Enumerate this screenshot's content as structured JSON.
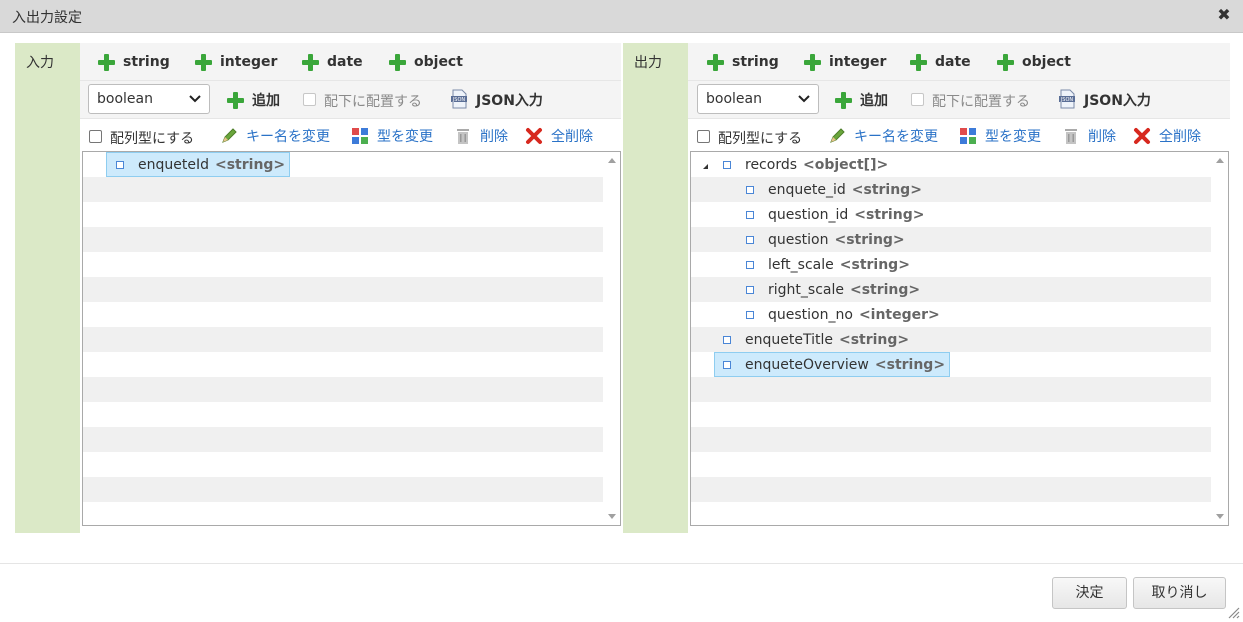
{
  "dialog": {
    "title": "入出力設定",
    "close_icon": "close-icon"
  },
  "input_panel": {
    "label": "入力",
    "type_buttons": [
      "string",
      "integer",
      "date",
      "object"
    ],
    "type_select_value": "boolean",
    "add_label": "追加",
    "place_under_label": "配下に配置する",
    "json_input_label": "JSON入力",
    "array_type_label": "配列型にする",
    "rename_key_label": "キー名を変更",
    "change_type_label": "型を変更",
    "delete_label": "削除",
    "delete_all_label": "全削除",
    "tree": [
      {
        "name": "enqueteId",
        "type": "<string>",
        "selected": true
      }
    ]
  },
  "output_panel": {
    "label": "出力",
    "type_buttons": [
      "string",
      "integer",
      "date",
      "object"
    ],
    "type_select_value": "boolean",
    "add_label": "追加",
    "place_under_label": "配下に配置する",
    "json_input_label": "JSON入力",
    "array_type_label": "配列型にする",
    "rename_key_label": "キー名を変更",
    "change_type_label": "型を変更",
    "delete_label": "削除",
    "delete_all_label": "全削除",
    "tree": [
      {
        "name": "records",
        "type": "<object[]>",
        "expanded": true
      },
      {
        "name": "enquete_id",
        "type": "<string>"
      },
      {
        "name": "question_id",
        "type": "<string>"
      },
      {
        "name": "question",
        "type": "<string>"
      },
      {
        "name": "left_scale",
        "type": "<string>"
      },
      {
        "name": "right_scale",
        "type": "<string>"
      },
      {
        "name": "question_no",
        "type": "<integer>"
      },
      {
        "name": "enqueteTitle",
        "type": "<string>"
      },
      {
        "name": "enqueteOverview",
        "type": "<string>",
        "selected": true
      }
    ]
  },
  "footer": {
    "ok_label": "決定",
    "cancel_label": "取り消し"
  },
  "colors": {
    "side_label_bg": "#dbe9c7",
    "plus_green": "#3aa63a",
    "link_blue": "#2a72c7",
    "selection_bg": "#cdeafc"
  }
}
